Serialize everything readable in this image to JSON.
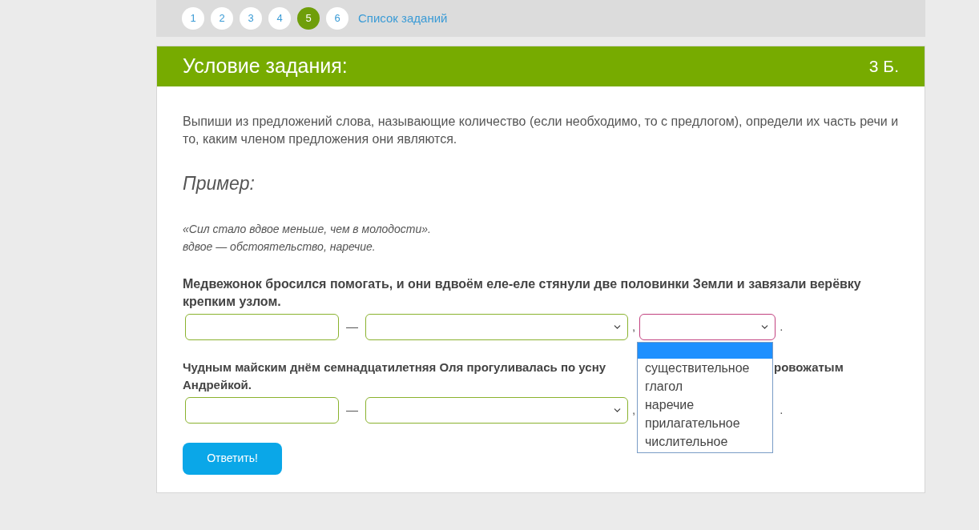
{
  "pagination": {
    "pages": [
      {
        "label": "1",
        "selected": false
      },
      {
        "label": "2",
        "selected": false
      },
      {
        "label": "3",
        "selected": false
      },
      {
        "label": "4",
        "selected": false
      },
      {
        "label": "5",
        "selected": true
      },
      {
        "label": "6",
        "selected": false
      }
    ],
    "list_link": "Список заданий"
  },
  "task": {
    "title": "Условие задания:",
    "points": "3 Б.",
    "instruction": "Выпиши из предложений слова, называющие количество (если необходимо, то с предлогом), определи их часть речи и то, каким членом предложения они являются.",
    "example_heading": "Пример:",
    "example_lines": [
      "«Сил стало вдвое меньше, чем в молодости».",
      "вдвое — обстоятельство, наречие."
    ]
  },
  "questions": [
    {
      "sentence": "Медвежонок бросился помогать, и они вдвоём еле-еле стянули две половинки Земли и завязали верёвку крепким узлом.",
      "dash": "—",
      "comma": ",",
      "period": ".",
      "dropdown": {
        "open": true,
        "blank_option_highlighted": true,
        "options": [
          "существительное",
          "глагол",
          "наречие",
          "прилагательное",
          "числительное"
        ]
      }
    },
    {
      "sentence_lead": "Чудным майским днём семнадцатилетняя Оля прогуливалась по усну",
      "sentence_tail": "ровожатым",
      "sentence_line2": "Андрейкой.",
      "dash": "—",
      "comma": ",",
      "period": "."
    }
  ],
  "answer_button": "Ответить!"
}
